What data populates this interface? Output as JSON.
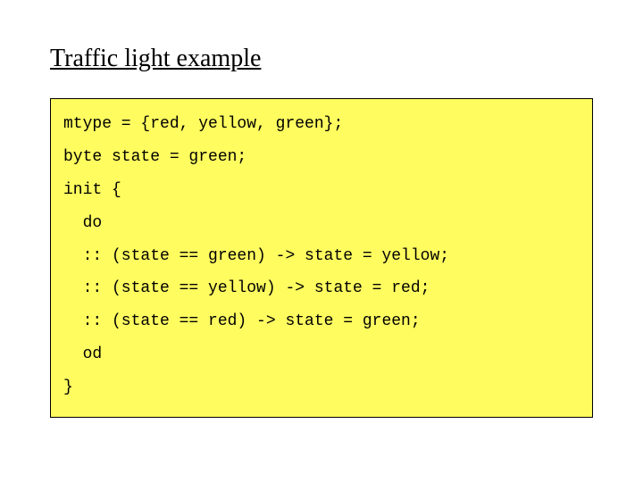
{
  "title": "Traffic light example",
  "code": {
    "l1": "mtype = {red, yellow, green};",
    "l2": "byte state = green;",
    "l3": "init {",
    "l4": "  do",
    "l5": "  :: (state == green) -> state = yellow;",
    "l6": "  :: (state == yellow) -> state = red;",
    "l7": "  :: (state == red) -> state = green;",
    "l8": "  od",
    "l9": "}"
  }
}
